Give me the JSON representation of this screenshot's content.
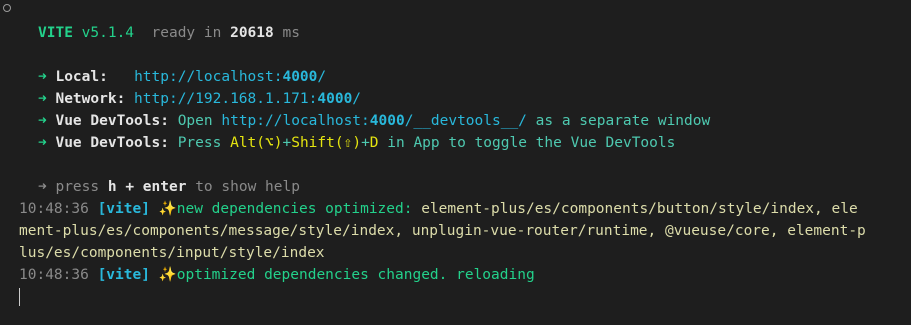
{
  "banner": {
    "vite": "VITE",
    "version": "v5.1.4",
    "ready": "ready in",
    "ms_value": "20618",
    "ms_unit": "ms"
  },
  "urls": [
    {
      "arrow": "➜",
      "label": "Local:",
      "pad": "   ",
      "pre": "http://localhost:",
      "port": "4000",
      "post": "/"
    },
    {
      "arrow": "➜",
      "label": "Network:",
      "pad": " ",
      "pre": "http://192.168.1.171:",
      "port": "4000",
      "post": "/"
    }
  ],
  "devtools1": {
    "arrow": "➜",
    "label": "Vue DevTools:",
    "text1": "Open ",
    "url_pre": "http://localhost:",
    "port": "4000",
    "url_post": "/__devtools__/",
    "text2": " as a separate window"
  },
  "devtools2": {
    "arrow": "➜",
    "label": "Vue DevTools:",
    "text1": "Press ",
    "alt": "Alt(⌥)",
    "plus1": "+",
    "shift": "Shift(⇧)",
    "plus2": "+",
    "d": "D",
    "text2": " in App to toggle the Vue DevTools"
  },
  "help": {
    "arrow": "➜",
    "press": "press",
    "h": "h",
    "plus": "+",
    "enter": "enter",
    "rest": "to show help"
  },
  "logs": {
    "time1": "10:48:36",
    "tag1": "[vite]",
    "sparkle1": "✨",
    "msg1": "new dependencies optimized:",
    "deps_line1": "element-plus/es/components/button/style/index, ele",
    "deps_line2": "ment-plus/es/components/message/style/index, unplugin-vue-router/runtime, @vueuse/core, element-p",
    "deps_line3": "lus/es/components/input/style/index",
    "time2": "10:48:36",
    "tag2": "[vite]",
    "sparkle2": "✨",
    "msg2": "optimized dependencies changed. reloading"
  }
}
